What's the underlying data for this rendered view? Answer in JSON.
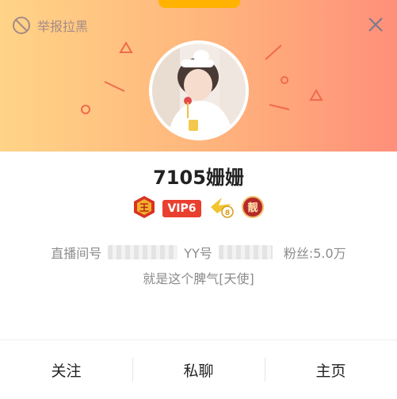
{
  "header": {
    "report_label": "举报拉黑",
    "close_icon": "close-icon"
  },
  "profile": {
    "name": "7105姗姗",
    "badges": {
      "anchor_badge": "王",
      "vip_label": "VIP6",
      "wing_badge": "8",
      "style_badge": "靓"
    },
    "room_label": "直播间号",
    "yy_label": "YY号",
    "fans_text": "粉丝:5.0万",
    "signature": "就是这个脾气[天使]"
  },
  "actions": {
    "follow_label": "关注",
    "chat_label": "私聊",
    "home_label": "主页"
  },
  "colors": {
    "banner_start": "#ffd487",
    "banner_end": "#ff8f7a",
    "vip_red": "#e93f2f",
    "text_dark": "#222222",
    "text_muted": "#8c8c8c"
  }
}
